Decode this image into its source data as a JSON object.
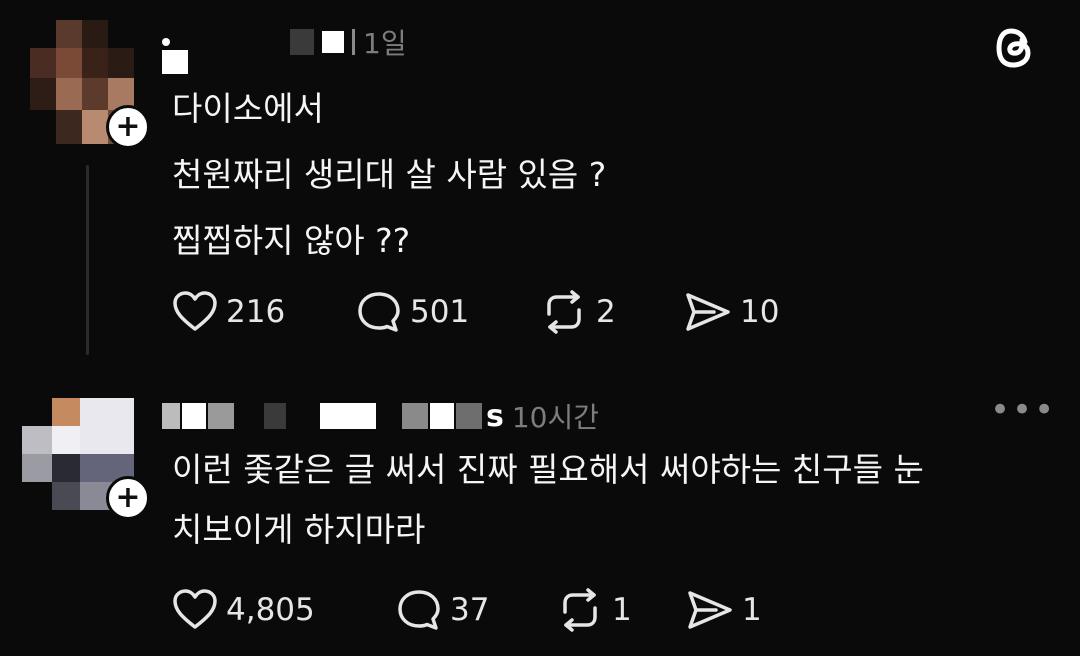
{
  "post1": {
    "timestamp": "1일",
    "text_lines": [
      "다이소에서",
      "천원짜리 생리대 살 사람 있음 ?",
      "찝찝하지 않아 ??"
    ],
    "stats": {
      "likes": "216",
      "comments": "501",
      "reposts": "2",
      "shares": "10"
    },
    "icons": {
      "brand": "threads-logo-icon",
      "follow": "plus-icon"
    }
  },
  "post2": {
    "username_visible": "s",
    "timestamp": "10시간",
    "text_lines": [
      "이런 좇같은 글 써서 진짜 필요해서 써야하는 친구들 눈",
      "치보이게 하지마라"
    ],
    "stats": {
      "likes": "4,805",
      "comments": "37",
      "reposts": "1",
      "shares": "1"
    },
    "icons": {
      "more": "more-horizontal-icon",
      "follow": "plus-icon"
    }
  },
  "follow_symbol": "+",
  "more_symbol": "•••"
}
